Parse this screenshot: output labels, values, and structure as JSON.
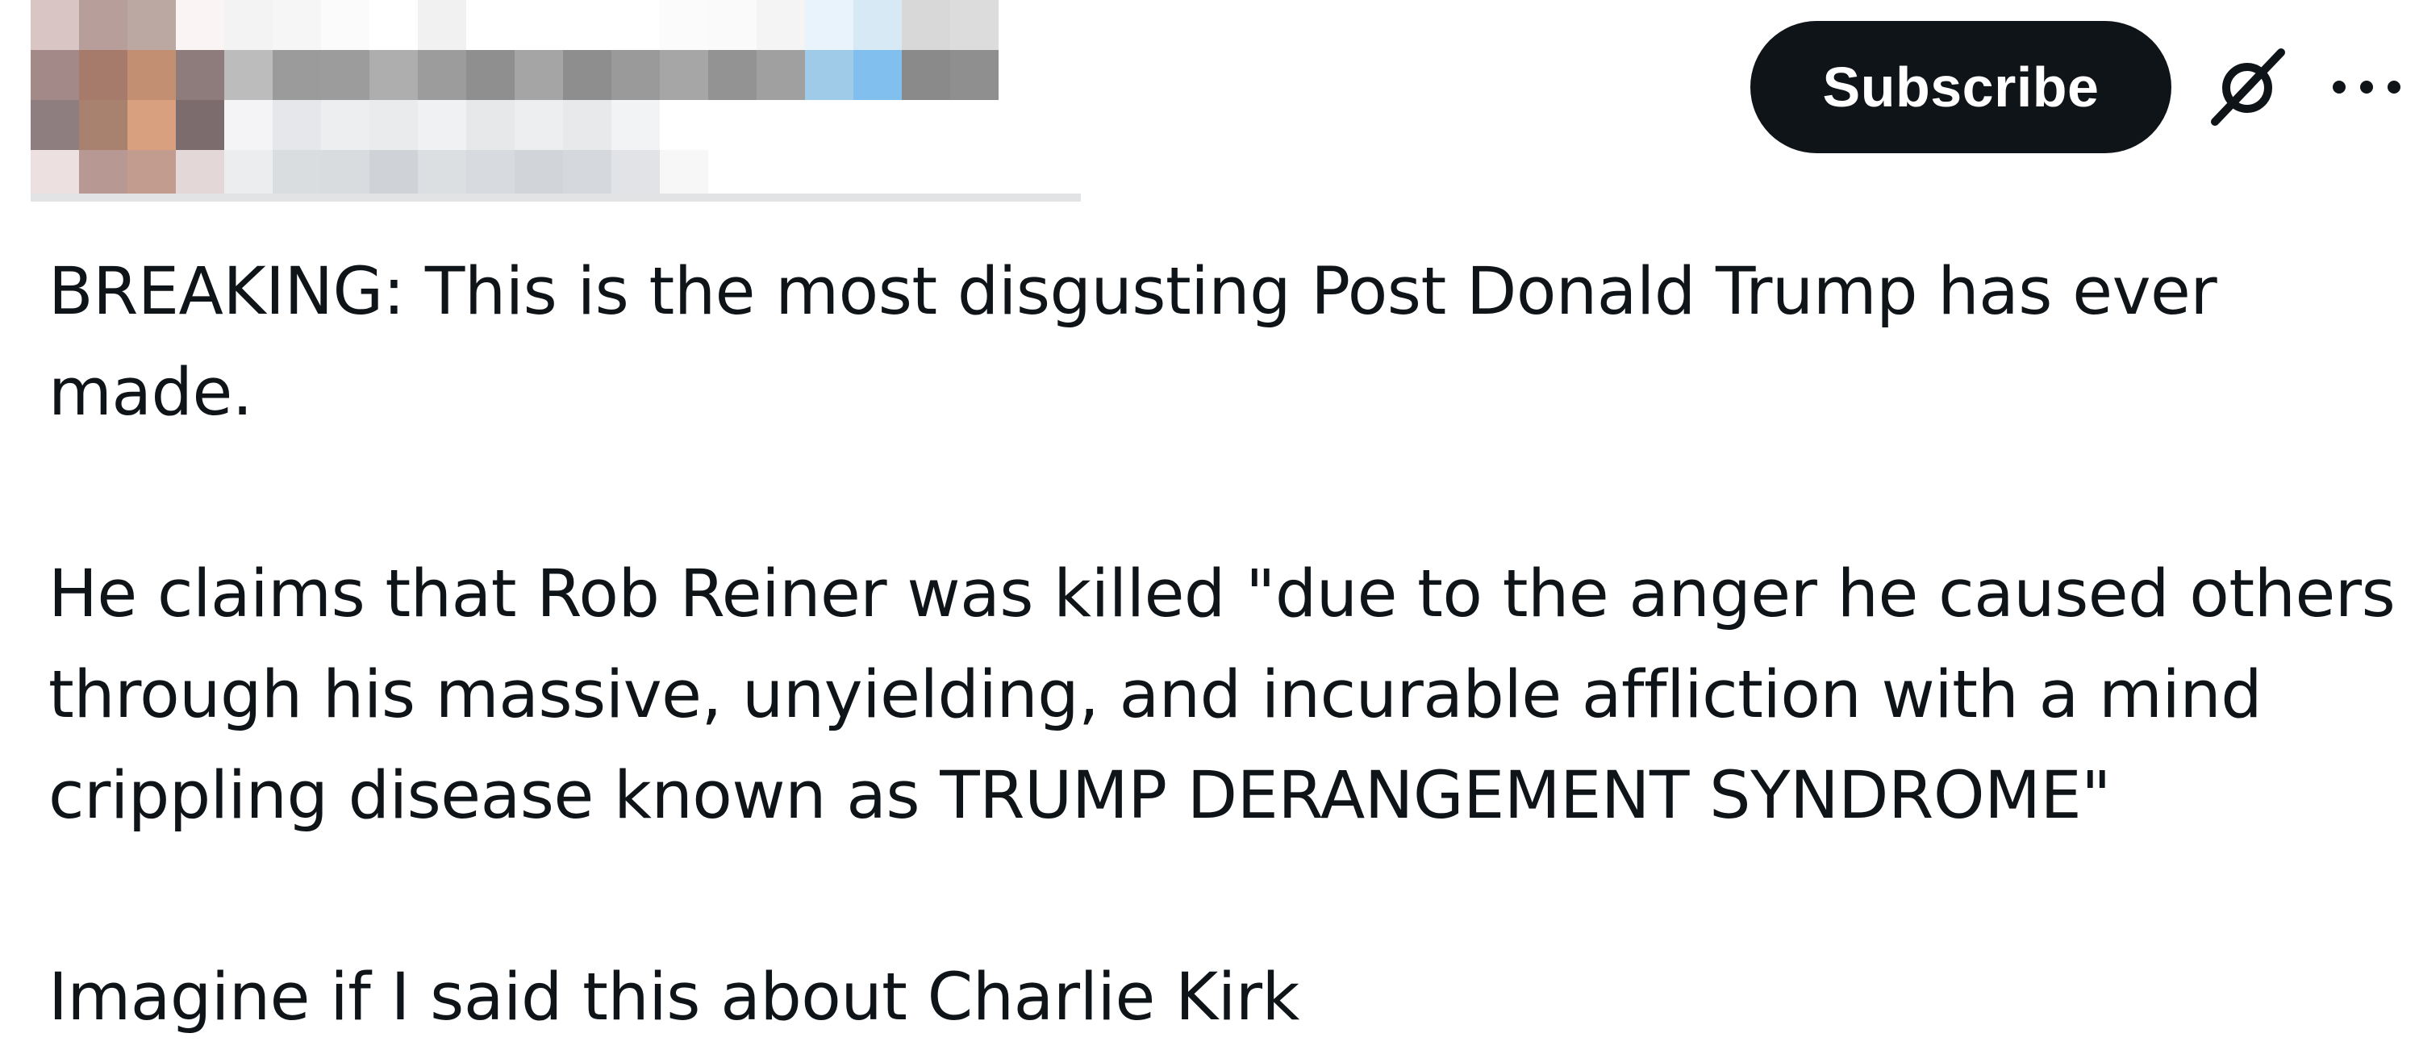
{
  "header": {
    "subscribe_label": "Subscribe",
    "grok_icon": "grok-slash-icon",
    "more_icon": "more-horizontal-icon",
    "avatar": "pixelated-avatar",
    "mosaic_colors": [
      [
        "#d9c6c4",
        "#b89e9a",
        "#bca8a3",
        "#faf5f4",
        "#f3f3f3",
        "#f6f6f6",
        "#fbfbfb",
        "#ffffff",
        "#f1f1f1",
        "#ffffff",
        "#ffffff",
        "#ffffff",
        "#ffffff",
        "#fbfbfb",
        "#fafafa",
        "#f4f4f4",
        "#e8f3fb",
        "#d8e9f6",
        "#d8d8d8",
        "#dcdcdc"
      ],
      [
        "#a38a88",
        "#a77b6c",
        "#c28f73",
        "#8e7b7c",
        "#bcbcbc",
        "#9b9b9b",
        "#9c9c9c",
        "#aeaeae",
        "#9c9c9c",
        "#8f8f8f",
        "#a5a5a5",
        "#8e8e8e",
        "#9a9a9a",
        "#a6a6a6",
        "#939393",
        "#a0a0a0",
        "#9fcbe8",
        "#81c0ee",
        "#8a8a8a",
        "#8f8f8f"
      ],
      [
        "#8e7e80",
        "#a8826f",
        "#d8a07f",
        "#7c6c6e",
        "#f4f4f6",
        "#e5e7ea",
        "#eceef0",
        "#e9ebed",
        "#eff1f3",
        "#e6e8ea",
        "#eceef0",
        "#e7e9eb",
        "#f2f3f4",
        "#ffffff",
        "#ffffff",
        "#ffffff",
        "#ffffff",
        "#ffffff",
        "#ffffff",
        "#ffffff"
      ],
      [
        "#ece0e0",
        "#b89892",
        "#c39c90",
        "#e4d7d7",
        "#ecedef",
        "#dadde0",
        "#d9dcdf",
        "#cfd2d6",
        "#dcdfe2",
        "#d7dade",
        "#d1d4d8",
        "#d5d8dc",
        "#e1e3e6",
        "#f7f7f8",
        "#ffffff",
        "#ffffff",
        "#ffffff",
        "#ffffff",
        "#ffffff",
        "#ffffff"
      ]
    ]
  },
  "post": {
    "line1": "BREAKING: This is the most disgusting Post Donald Trump has ever",
    "line2": "made.",
    "line3": "He claims that Rob Reiner was killed \"due to the anger he caused others",
    "line4": "through his massive, unyielding, and incurable affliction with a mind",
    "line5": "crippling disease known as TRUMP DERANGEMENT SYNDROME\"",
    "line6": "Imagine if I said this about Charlie Kirk"
  },
  "colors": {
    "text": "#0f1419",
    "button_bg": "#0f1419",
    "button_text": "#ffffff",
    "background": "#ffffff"
  }
}
